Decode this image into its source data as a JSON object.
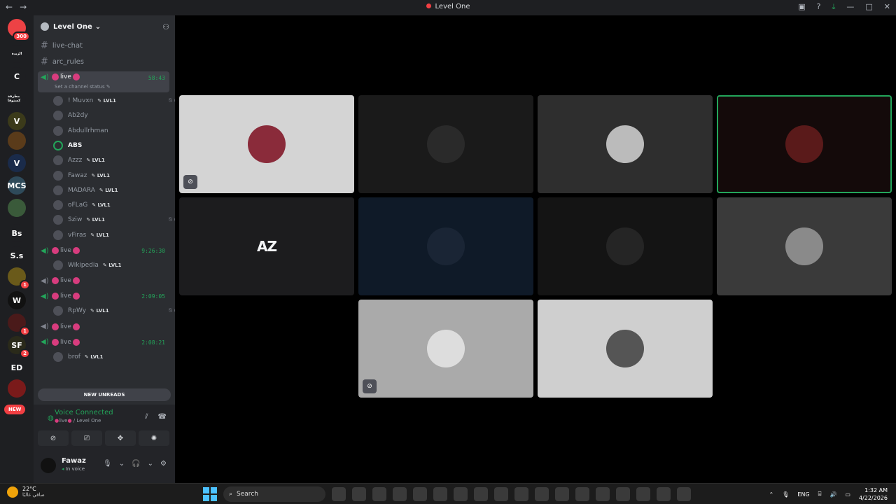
{
  "window": {
    "title": "Level One"
  },
  "servers": {
    "items": [
      {
        "label": "",
        "icon": "discord-home-icon",
        "badge": "300",
        "color": "#ed4245"
      },
      {
        "label": "الزبدة",
        "icon": "server-icon",
        "color": "#1e1f22"
      },
      {
        "label": "C",
        "icon": "server-icon",
        "color": "#1e1f22"
      },
      {
        "label": "مطرقة كستوفا",
        "icon": "server-icon",
        "color": "#1e1f22"
      },
      {
        "label": "V",
        "icon": "server-icon",
        "color": "#3b3a1a"
      },
      {
        "label": "",
        "icon": "crown-icon",
        "color": "#5a3b1a"
      },
      {
        "label": "V",
        "icon": "server-icon",
        "color": "#1a2b4a"
      },
      {
        "label": "MCS",
        "icon": "server-icon",
        "color": "#2e4a5a"
      },
      {
        "label": "",
        "icon": "badge-icon",
        "color": "#3a5a3a"
      },
      {
        "label": "Bs",
        "icon": "server-icon",
        "color": "#1e1f22"
      },
      {
        "label": "S.s",
        "icon": "server-icon",
        "color": "#1e1f22"
      },
      {
        "label": "",
        "icon": "lion-icon",
        "badge": "1",
        "color": "#6a5a1a"
      },
      {
        "label": "W",
        "icon": "server-icon",
        "color": "#111"
      },
      {
        "label": "",
        "icon": "raider-icon",
        "badge": "1",
        "color": "#4a1a1a"
      },
      {
        "label": "SF",
        "icon": "server-icon",
        "badge": "2",
        "color": "#2a2a1a"
      },
      {
        "label": "ED",
        "icon": "server-icon",
        "color": "#1e1f22"
      },
      {
        "label": "",
        "icon": "dragon-icon",
        "color": "#7a1a1a"
      }
    ],
    "new_label": "NEW"
  },
  "guild": {
    "name": "Level One",
    "add_member_icon": "add-member-icon"
  },
  "channels": {
    "text": [
      {
        "name": "live-chat"
      },
      {
        "name": "arc_rules"
      }
    ],
    "voice": [
      {
        "name": "live",
        "timer": "58:43",
        "status": "Set a channel status",
        "active": true,
        "members": [
          {
            "name": "! Muvxn",
            "tag": "LVL1",
            "muted": true
          },
          {
            "name": "Ab2dy",
            "tag": "",
            "muted": false
          },
          {
            "name": "Abdullrhman",
            "tag": "",
            "muted": false
          },
          {
            "name": "ABS",
            "tag": "",
            "muted": false,
            "speaking": true
          },
          {
            "name": "Azzz",
            "tag": "LVL1",
            "muted": false
          },
          {
            "name": "Fawaz",
            "tag": "LVL1",
            "muted": false
          },
          {
            "name": "MADARA",
            "tag": "LVL1",
            "muted": false
          },
          {
            "name": "oFLaG",
            "tag": "LVL1",
            "muted": false
          },
          {
            "name": "Sziw",
            "tag": "LVL1",
            "muted": true
          },
          {
            "name": "vFiras",
            "tag": "LVL1",
            "muted": false
          }
        ]
      },
      {
        "name": "live",
        "timer": "9:26:30",
        "members": [
          {
            "name": "Wikipedia",
            "tag": "LVL1",
            "muted": false
          }
        ]
      },
      {
        "name": "live",
        "timer": "",
        "members": []
      },
      {
        "name": "live",
        "timer": "2:09:05",
        "members": [
          {
            "name": "RpWy",
            "tag": "LVL1",
            "muted": true
          }
        ]
      },
      {
        "name": "live",
        "timer": "",
        "members": []
      },
      {
        "name": "live",
        "timer": "2:08:21",
        "members": [
          {
            "name": "brof",
            "tag": "LVL1",
            "muted": false
          }
        ]
      }
    ],
    "new_unreads": "NEW UNREADS"
  },
  "voice_panel": {
    "title": "Voice Connected",
    "channel": "live",
    "guild": "/ Level One"
  },
  "me": {
    "name": "Fawaz",
    "status": "In voice"
  },
  "stage": {
    "tiles": [
      {
        "bg": "#d4d4d4",
        "avatar": "#8a2b3a",
        "muted": true
      },
      {
        "bg": "#1a1a1a",
        "avatar": "#2a2a2a",
        "muted": false
      },
      {
        "bg": "#2e2e2e",
        "avatar": "#bbbbbb",
        "muted": false
      },
      {
        "bg": "#140a0a",
        "avatar": "#5a1a1a",
        "muted": false,
        "selected": true
      },
      {
        "bg": "#1c1c1e",
        "text": "AZ",
        "muted": false
      },
      {
        "bg": "#0f1a28",
        "avatar": "#1a2535",
        "muted": false
      },
      {
        "bg": "#141414",
        "avatar": "#252525",
        "muted": false
      },
      {
        "bg": "#3a3a3a",
        "avatar": "#8a8a8a",
        "muted": false
      },
      {
        "bg": "#aaaaaa",
        "avatar": "#dddddd",
        "muted": true
      },
      {
        "bg": "#cfcfcf",
        "avatar": "#555555",
        "muted": false
      }
    ]
  },
  "taskbar": {
    "temp": "22°C",
    "weather": "صافي غالبًا",
    "search_placeholder": "Search",
    "apps": [
      "file-explorer-icon",
      "folder-icon",
      "store-icon",
      "obs-icon",
      "chrome-icon",
      "discord-icon",
      "excel-icon",
      "steam-icon",
      "terminal-icon",
      "red-app-icon",
      "purple-app-icon",
      "notepad-icon",
      "blue-app-icon",
      "epic-icon",
      "orange-app-icon",
      "app-icon",
      "fortnite-icon",
      "dark-app-icon"
    ],
    "lang": "ENG",
    "time": "1:32 AM",
    "date": "4/22/2026"
  }
}
